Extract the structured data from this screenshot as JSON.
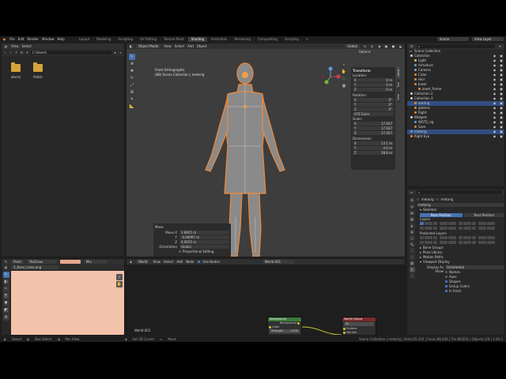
{
  "topbar": {
    "menus": [
      "File",
      "Edit",
      "Render",
      "Window",
      "Help"
    ],
    "workspaces": [
      "Layout",
      "Modeling",
      "Sculpting",
      "UV Editing",
      "Texture Paint",
      "Shading",
      "Animation",
      "Rendering",
      "Compositing",
      "Scripting",
      "+"
    ],
    "active_workspace": "Shading",
    "scene": "Scene",
    "view_layer": "View Layer"
  },
  "file_browser": {
    "menus": [
      "View",
      "Select"
    ],
    "path": "C:\\Users\\",
    "items": [
      {
        "name": "abcmi"
      },
      {
        "name": "Public"
      }
    ]
  },
  "viewport": {
    "header": {
      "mode": "Object Mode",
      "menus": [
        "View",
        "Select",
        "Add",
        "Object"
      ],
      "orientation": "Global"
    },
    "overlay_title": "Front Orthographic",
    "overlay_subtitle": "(88) Scene Collection | metarig",
    "options_label": "Options",
    "sidebar_tabs": [
      "Item",
      "Tool",
      "View"
    ],
    "transform": {
      "title": "Transform",
      "location_label": "Location:",
      "location": [
        {
          "axis": "X",
          "value": "0 m"
        },
        {
          "axis": "Y",
          "value": "0 m"
        },
        {
          "axis": "Z",
          "value": "0 m"
        }
      ],
      "rotation_label": "Rotation:",
      "rotation": [
        {
          "axis": "X",
          "value": "0°"
        },
        {
          "axis": "Y",
          "value": "0°"
        },
        {
          "axis": "Z",
          "value": "0°"
        }
      ],
      "rotation_mode": "XYZ Euler",
      "scale_label": "Scale:",
      "scale": [
        {
          "axis": "X",
          "value": "17.937"
        },
        {
          "axis": "Y",
          "value": "17.937"
        },
        {
          "axis": "Z",
          "value": "17.937"
        }
      ],
      "dimensions_label": "Dimensions:",
      "dimensions": [
        {
          "axis": "X",
          "value": "13.1 m"
        },
        {
          "axis": "Y",
          "value": "4.6 m"
        },
        {
          "axis": "Z",
          "value": "28.8 m"
        }
      ]
    },
    "move_panel": {
      "title": "Move",
      "fields": [
        {
          "label": "Move X",
          "value": "2.8925 m"
        },
        {
          "label": "Y",
          "value": "-0.00097 m"
        },
        {
          "label": "Z",
          "value": "4.0035 m"
        }
      ],
      "orientation_label": "Orientation",
      "orientation_value": "Global",
      "proportional": "Proportional Editing"
    }
  },
  "outliner": {
    "title": "Scene Collection",
    "rows": [
      {
        "name": "Collection",
        "indent": 0,
        "color": "#cfcfcf",
        "selected": false
      },
      {
        "name": "Light",
        "indent": 1,
        "color": "#e0c050",
        "selected": false
      },
      {
        "name": "Armature",
        "indent": 1,
        "color": "#5ca0d0",
        "selected": false
      },
      {
        "name": "Camera",
        "indent": 1,
        "color": "#8aa8c8",
        "selected": false
      },
      {
        "name": "Cube",
        "indent": 1,
        "color": "#e08a3a",
        "selected": false
      },
      {
        "name": "Hair",
        "indent": 1,
        "color": "#e08a3a",
        "selected": false
      },
      {
        "name": "Jewel",
        "indent": 1,
        "color": "#e08a3a",
        "selected": false
      },
      {
        "name": "Jewel_frame",
        "indent": 2,
        "color": "#e08a3a",
        "selected": false
      },
      {
        "name": "Collection 2",
        "indent": 0,
        "color": "#cfcfcf",
        "selected": false
      },
      {
        "name": "Collection 3",
        "indent": 0,
        "color": "#cfcfcf",
        "selected": false
      },
      {
        "name": "earring",
        "indent": 1,
        "color": "#e08a3a",
        "selected": true
      },
      {
        "name": "glasses",
        "indent": 1,
        "color": "#e08a3a",
        "selected": false
      },
      {
        "name": "Right",
        "indent": 1,
        "color": "#e08a3a",
        "selected": false
      },
      {
        "name": "Widgets",
        "indent": 0,
        "color": "#cfcfcf",
        "selected": false
      },
      {
        "name": "WGTS_rig",
        "indent": 1,
        "color": "#5ca0d0",
        "selected": false
      },
      {
        "name": "Sack",
        "indent": 1,
        "color": "#e08a3a",
        "selected": false
      },
      {
        "name": "metarig",
        "indent": 0,
        "color": "#5ca0d0",
        "selected": true
      },
      {
        "name": "Right Eye",
        "indent": 0,
        "color": "#e08a3a",
        "selected": false
      }
    ]
  },
  "properties": {
    "object_label": "metarig",
    "data_label": "metarig",
    "data_field": "metarig",
    "skeleton_label": "Skeleton",
    "pose_position": "Pose Position",
    "rest_position": "Rest Position",
    "layers_label": "Layers",
    "protected_layers_label": "Protected Layers",
    "sections": [
      "Bone Groups",
      "Pose Library",
      "Motion Paths"
    ],
    "viewport_display": "Viewport Display",
    "display_as_label": "Display As",
    "display_as_value": "Octahedral",
    "show_label": "Show",
    "show_options": [
      {
        "label": "Names",
        "checked": false
      },
      {
        "label": "Axes",
        "checked": false
      },
      {
        "label": "Shapes",
        "checked": true
      },
      {
        "label": "Group Colors",
        "checked": true
      },
      {
        "label": "In Front",
        "checked": true
      }
    ]
  },
  "image_editor": {
    "mode": "Paint",
    "brush": "TexDraw",
    "blend": "Mix",
    "image_name": "2_Base_Color.png",
    "brush_color": "#e6a88e",
    "canvas_color": "#f2c2aa"
  },
  "node_editor": {
    "type": "World",
    "menus": [
      "View",
      "Select",
      "Add",
      "Node"
    ],
    "use_nodes_label": "Use Nodes",
    "world_name": "World.001",
    "footer_label": "World.001",
    "background_node": {
      "title": "Background",
      "output": "Background",
      "color_label": "Color",
      "strength_label": "Strength",
      "strength_value": "1.000"
    },
    "output_node": {
      "title": "World Output",
      "target": "All",
      "surface_label": "Surface",
      "volume_label": "Volume"
    }
  },
  "statusbar": {
    "left": [
      "Select",
      "Box Select",
      "Pan View",
      "Set 3D Cursor",
      "Move"
    ],
    "right": "Scene Collection | metarig | Verts:45,410 | Faces:88,436 | Tris:89,816 | Objects:1/9 | 2.93.2"
  }
}
